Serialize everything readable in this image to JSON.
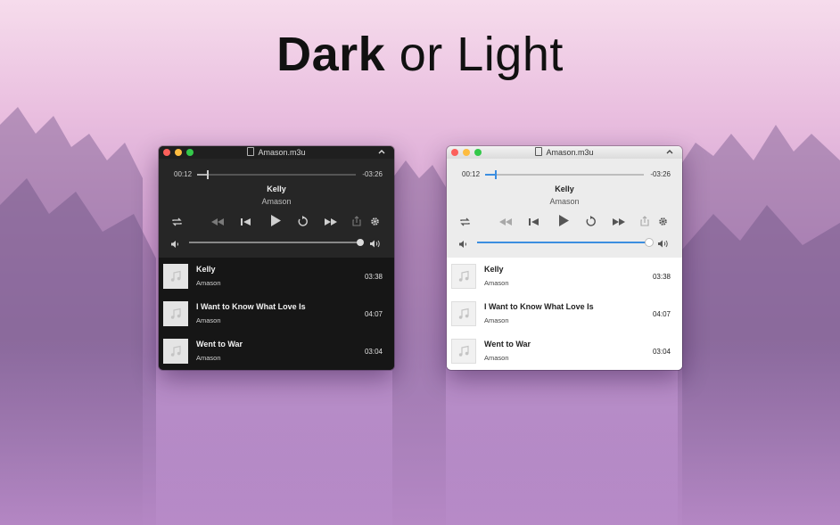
{
  "headline": {
    "bold": "Dark",
    "rest": "or Light"
  },
  "colors": {
    "accent_light": "#3c8ee0",
    "dark_bg": "#262626",
    "light_bg": "#ececec"
  },
  "windows": [
    {
      "theme": "dark",
      "title": "Amason.m3u",
      "elapsed": "00:12",
      "remaining": "-03:26",
      "progress_fraction": 0.06,
      "volume_fraction": 1.0,
      "now_playing": {
        "title": "Kelly",
        "artist": "Amason"
      },
      "tracks": [
        {
          "title": "Kelly",
          "artist": "Amason",
          "duration": "03:38"
        },
        {
          "title": "I Want to Know What Love Is",
          "artist": "Amason",
          "duration": "04:07"
        },
        {
          "title": "Went to War",
          "artist": "Amason",
          "duration": "03:04"
        }
      ]
    },
    {
      "theme": "light",
      "title": "Amason.m3u",
      "elapsed": "00:12",
      "remaining": "-03:26",
      "progress_fraction": 0.06,
      "volume_fraction": 1.0,
      "now_playing": {
        "title": "Kelly",
        "artist": "Amason"
      },
      "tracks": [
        {
          "title": "Kelly",
          "artist": "Amason",
          "duration": "03:38"
        },
        {
          "title": "I Want to Know What Love Is",
          "artist": "Amason",
          "duration": "04:07"
        },
        {
          "title": "Went to War",
          "artist": "Amason",
          "duration": "03:04"
        }
      ]
    }
  ],
  "icons": [
    "repeat-icon",
    "rewind-icon",
    "previous-icon",
    "play-icon",
    "replay-icon",
    "fast-forward-icon",
    "share-icon",
    "gear-icon",
    "volume-low-icon",
    "volume-high-icon",
    "music-note-icon",
    "document-icon",
    "chevron-up-icon"
  ]
}
